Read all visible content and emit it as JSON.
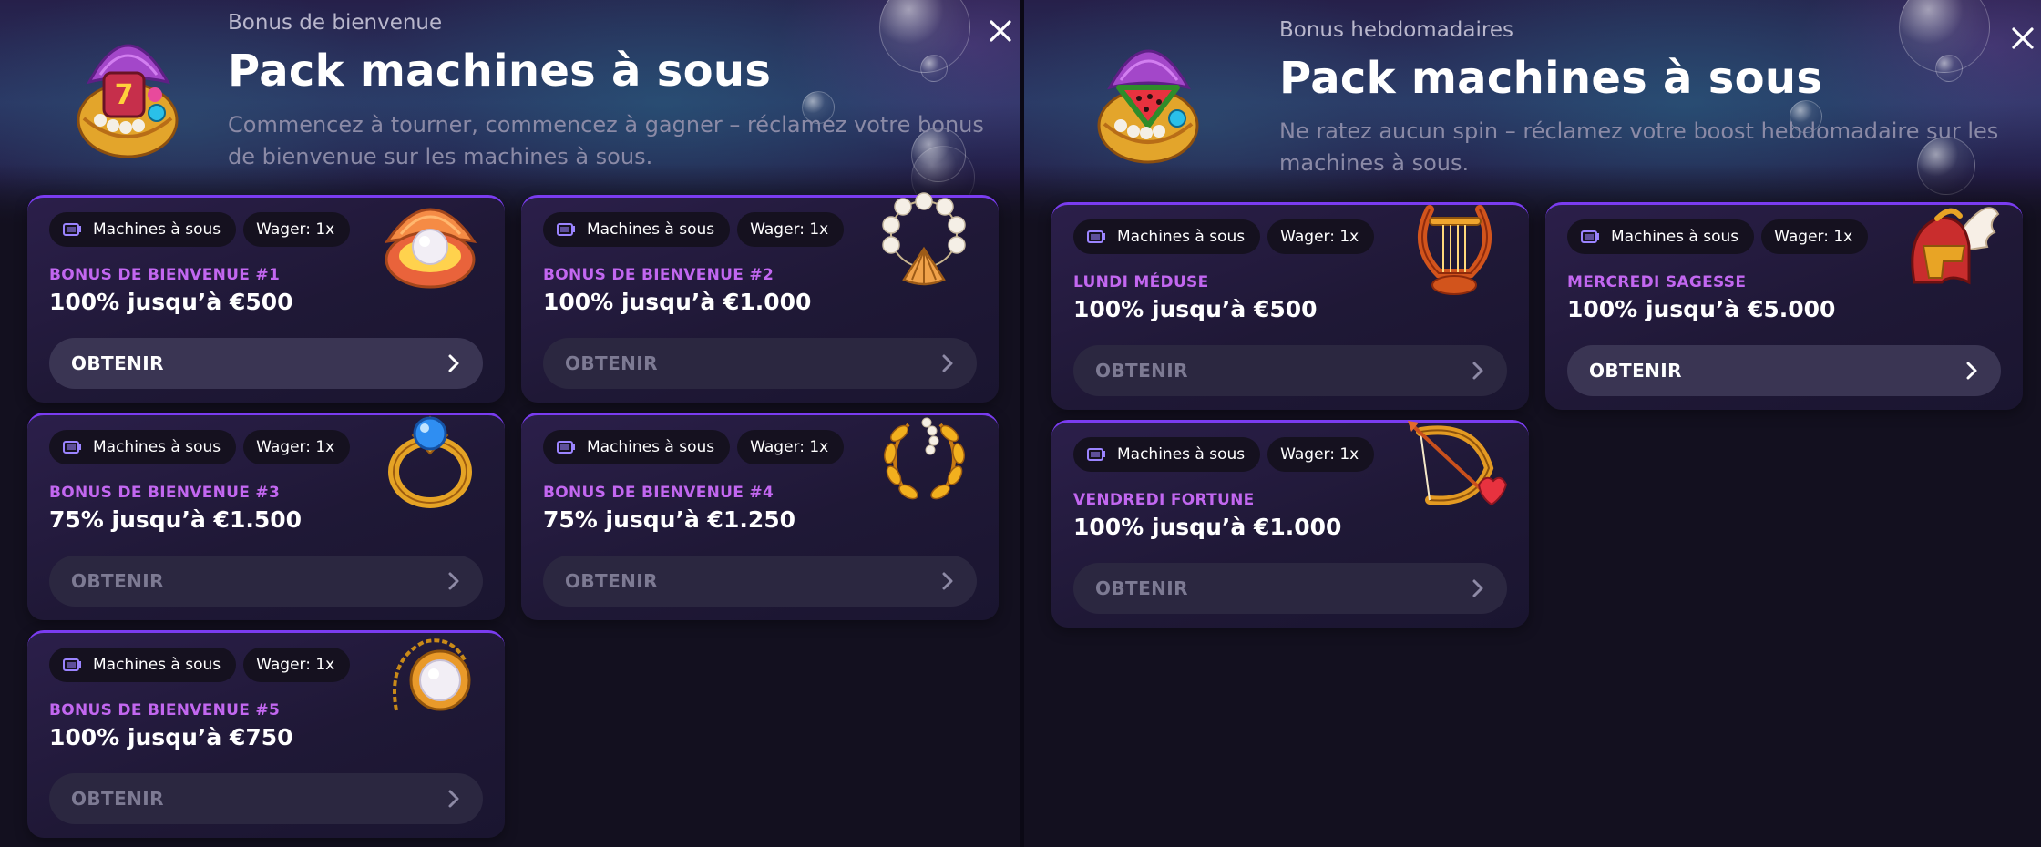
{
  "colors": {
    "accent": "#7a3cf0",
    "label": "#c267f0",
    "background": "#13101f",
    "card": "#1f1836"
  },
  "left_panel": {
    "subtitle": "Bonus de bienvenue",
    "title": "Pack machines à sous",
    "description": "Commencez à tourner, commencez à gagner – réclamez votre bonus de bienvenue sur les machines à sous.",
    "hero_icon": "treasure-shell-icon",
    "cards": [
      {
        "category": "Machines à sous",
        "wager": "Wager: 1x",
        "label": "BONUS DE BIENVENUE #1",
        "amount": "100% jusqu’à €500",
        "button": "OBTENIR",
        "art": "pearl-shell-icon",
        "active": true
      },
      {
        "category": "Machines à sous",
        "wager": "Wager: 1x",
        "label": "BONUS DE BIENVENUE #2",
        "amount": "100% jusqu’à €1.000",
        "button": "OBTENIR",
        "art": "pearl-bracelet-icon",
        "active": false
      },
      {
        "category": "Machines à sous",
        "wager": "Wager: 1x",
        "label": "BONUS DE BIENVENUE #3",
        "amount": "75% jusqu’à €1.500",
        "button": "OBTENIR",
        "art": "sapphire-ring-icon",
        "active": false
      },
      {
        "category": "Machines à sous",
        "wager": "Wager: 1x",
        "label": "BONUS DE BIENVENUE #4",
        "amount": "75% jusqu’à €1.250",
        "button": "OBTENIR",
        "art": "laurel-wreath-icon",
        "active": false
      },
      {
        "category": "Machines à sous",
        "wager": "Wager: 1x",
        "label": "BONUS DE BIENVENUE #5",
        "amount": "100% jusqu’à €750",
        "button": "OBTENIR",
        "art": "pearl-necklace-icon",
        "active": false
      }
    ]
  },
  "right_panel": {
    "subtitle": "Bonus hebdomadaires",
    "title": "Pack machines à sous",
    "description": "Ne ratez aucun spin – réclamez votre boost hebdomadaire sur les machines à sous.",
    "hero_icon": "watermelon-shell-icon",
    "cards": [
      {
        "category": "Machines à sous",
        "wager": "Wager: 1x",
        "label": "LUNDI MÉDUSE",
        "amount": "100% jusqu’à €500",
        "button": "OBTENIR",
        "art": "lyre-icon",
        "active": false
      },
      {
        "category": "Machines à sous",
        "wager": "Wager: 1x",
        "label": "MERCREDI SAGESSE",
        "amount": "100% jusqu’à €5.000",
        "button": "OBTENIR",
        "art": "winged-helmet-icon",
        "active": true
      },
      {
        "category": "Machines à sous",
        "wager": "Wager: 1x",
        "label": "VENDREDI FORTUNE",
        "amount": "100% jusqu’à €1.000",
        "button": "OBTENIR",
        "art": "cupid-bow-icon",
        "active": false
      }
    ]
  }
}
